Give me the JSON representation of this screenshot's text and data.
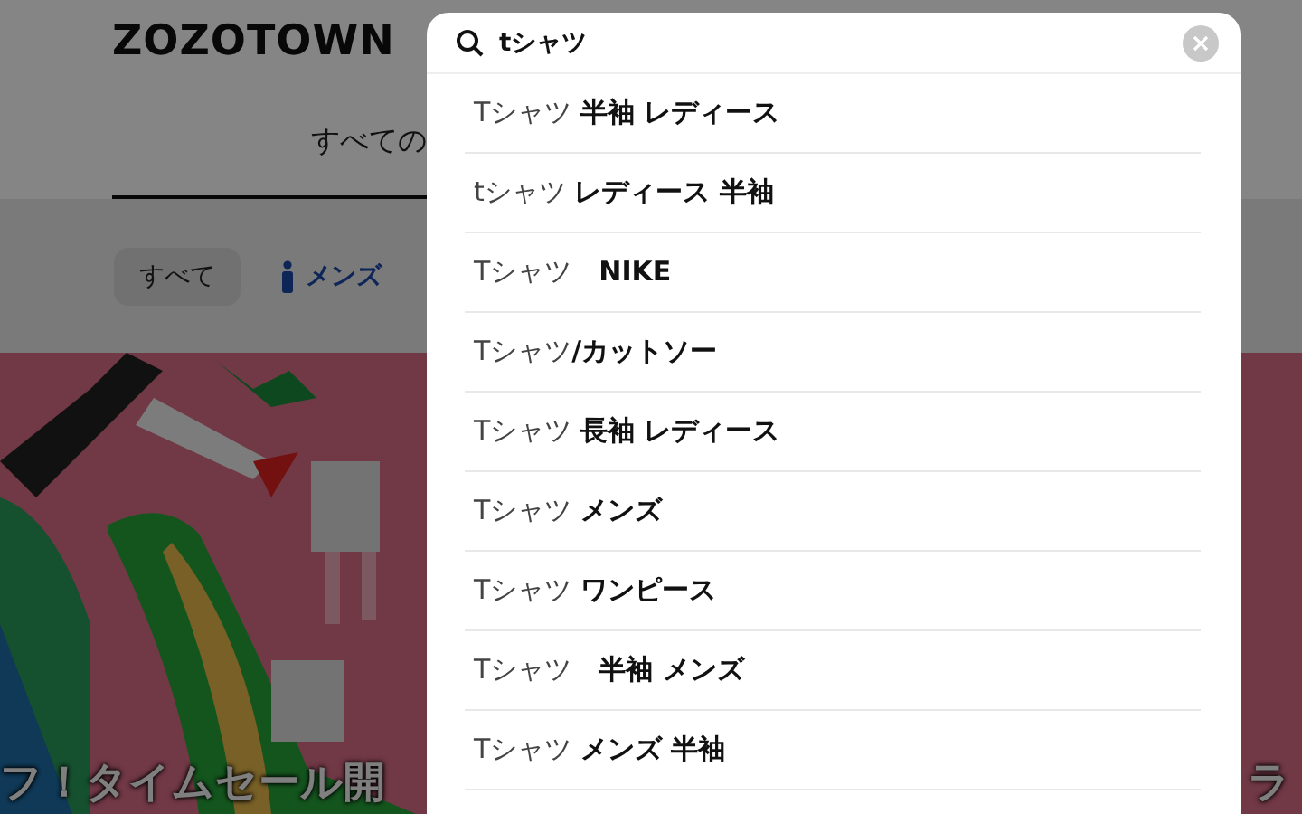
{
  "page": {
    "logo": "ZOZOTOWN",
    "tab": "すべての",
    "filters": [
      {
        "label": "すべて",
        "selected": true,
        "kind": "all"
      },
      {
        "label": "メンズ",
        "selected": false,
        "kind": "men"
      }
    ],
    "banner": {
      "kind": "picture",
      "captions": [
        "フ！タイムセール開",
        "ラ"
      ]
    }
  },
  "search": {
    "value": "tシャツ",
    "suggestions": [
      "Tシャツ **半袖 レディース**",
      "tシャツ **レディース 半袖**",
      "Tシャツ　**NIKE**",
      "Tシャツ**/カットソー**",
      "Tシャツ **長袖 レディース**",
      "Tシャツ **メンズ**",
      "Tシャツ **ワンピース**",
      "Tシャツ　**半袖 メンズ**",
      "Tシャツ **メンズ 半袖**"
    ]
  }
}
